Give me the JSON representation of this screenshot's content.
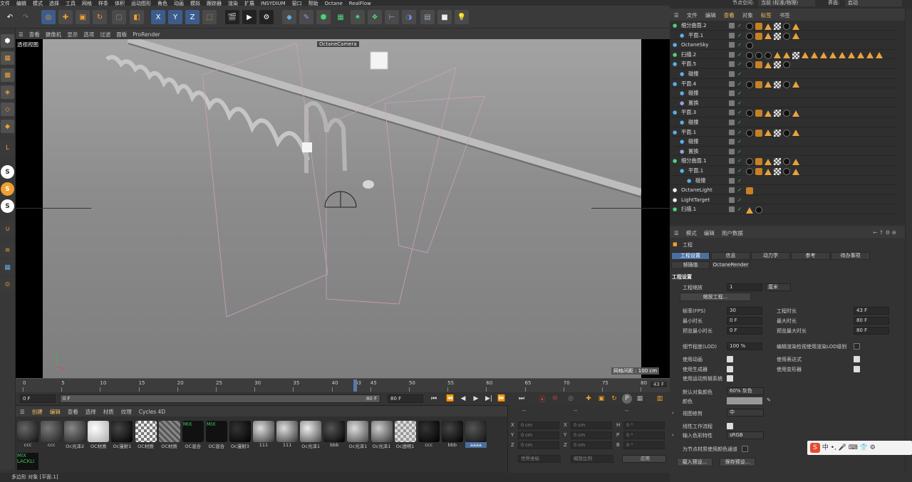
{
  "menubar": [
    "文件",
    "编辑",
    "模式",
    "选择",
    "工具",
    "网格",
    "样条",
    "体积",
    "运动图形",
    "角色",
    "动画",
    "模拟",
    "跟踪器",
    "渲染",
    "扩展",
    "INSYDIUM",
    "窗口",
    "帮助",
    "Octane",
    "RealFlow"
  ],
  "top_right": {
    "node_space_label": "节点空间:",
    "node_space_value": "当前 (标准/物理)",
    "interface_label": "界面:",
    "interface_value": "启动"
  },
  "viewport": {
    "menu": [
      "查看",
      "摄像机",
      "显示",
      "选项",
      "过滤",
      "面板",
      "ProRender"
    ],
    "label": "透视视图",
    "camera_label": "OctaneCamera",
    "grid_info": "网格间距 : 100 cm"
  },
  "timeline": {
    "ticks": [
      "0",
      "5",
      "10",
      "15",
      "20",
      "25",
      "30",
      "35",
      "40",
      "43",
      "45",
      "50",
      "55",
      "60",
      "65",
      "70",
      "75",
      "80"
    ],
    "current_frame": "43 F",
    "start_field": "0 F",
    "range_start": "0 F",
    "range_end": "80 F",
    "end_field": "80 F"
  },
  "materials": {
    "tabs": [
      "创建",
      "编辑",
      "查看",
      "选择",
      "材质",
      "纹理",
      "Cycles 4D"
    ],
    "items": [
      "ccc",
      "ccc",
      "Oc光泽2",
      "OC材质",
      "Oc漫射1",
      "OC材质",
      "OC材质",
      "OC混合",
      "OC混合",
      "Oc漫射3",
      "111",
      "111",
      "Oc光泽1",
      "bbb",
      "Oc光泽1",
      "Oc光泽1",
      "Oc透明1",
      "ccc",
      "bbb",
      "aaaa"
    ],
    "extra_label": "MIX\nLACKLI"
  },
  "coords": {
    "header": [
      "--",
      "--",
      "--"
    ],
    "rows": [
      {
        "a": "X",
        "v1": "0 cm",
        "b": "X",
        "v2": "0 cm",
        "c": "H",
        "v3": "0 °"
      },
      {
        "a": "Y",
        "v1": "0 cm",
        "b": "Y",
        "v2": "0 cm",
        "c": "P",
        "v3": "0 °"
      },
      {
        "a": "Z",
        "v1": "0 cm",
        "b": "Z",
        "v2": "0 cm",
        "c": "B",
        "v3": "0 °"
      }
    ],
    "mode": "世界坐标",
    "scale": "缩放比例",
    "apply": "应用"
  },
  "status": "多边形 对象 [平面.1]",
  "object_manager": {
    "menu": [
      "文件",
      "编辑",
      "查看",
      "对象",
      "标签",
      "书签"
    ],
    "rows": [
      {
        "name": "细分曲面.2",
        "indent": 0,
        "tags": "sotcst"
      },
      {
        "name": "平面.1",
        "indent": 1,
        "tags": "sotcst"
      },
      {
        "name": "OctaneSky",
        "indent": 0,
        "tags": "b"
      },
      {
        "name": "扫描.2",
        "indent": 0,
        "tags": "sssttcttttttttt"
      },
      {
        "name": "平面.5",
        "indent": 0,
        "tags": "sotcs"
      },
      {
        "name": "碰撞",
        "indent": 1,
        "tags": ""
      },
      {
        "name": "平面.4",
        "indent": 0,
        "tags": "sotcst"
      },
      {
        "name": "碰撞",
        "indent": 1,
        "tags": ""
      },
      {
        "name": "置换",
        "indent": 1,
        "tags": ""
      },
      {
        "name": "平面.3",
        "indent": 0,
        "tags": "sotcst"
      },
      {
        "name": "碰撞",
        "indent": 1,
        "tags": ""
      },
      {
        "name": "平面.1",
        "indent": 0,
        "tags": "sotcst"
      },
      {
        "name": "碰撞",
        "indent": 1,
        "tags": ""
      },
      {
        "name": "置换",
        "indent": 1,
        "tags": ""
      },
      {
        "name": "细分曲面.1",
        "indent": 0,
        "tags": "sotcst"
      },
      {
        "name": "平面.1",
        "indent": 1,
        "tags": "sotcst"
      },
      {
        "name": "碰撞",
        "indent": 2,
        "tags": ""
      },
      {
        "name": "OctaneLight",
        "indent": 0,
        "tags": "o"
      },
      {
        "name": "LightTarget",
        "indent": 0,
        "tags": ""
      },
      {
        "name": "扫描.1",
        "indent": 0,
        "tags": "ts"
      }
    ]
  },
  "attributes": {
    "menu": [
      "模式",
      "编辑",
      "用户数据"
    ],
    "title": "工程",
    "tabs": [
      "工程设置",
      "信息",
      "动力学",
      "参考",
      "待办事项",
      "帧插值",
      "OctaneRender"
    ],
    "section": "工程设置",
    "project_scale_label": "工程缩放",
    "project_scale_value": "1",
    "project_scale_unit": "厘米",
    "scale_project_btn": "缩放工程...",
    "fps_label": "帧率(FPS)",
    "fps_value": "30",
    "proj_len_label": "工程时长",
    "proj_len_value": "43 F",
    "min_len_label": "最小时长",
    "min_len_value": "0 F",
    "max_len_label": "最大时长",
    "max_len_value": "80 F",
    "prev_min_label": "预览最小时长",
    "prev_min_value": "0 F",
    "prev_max_label": "预览最大时长",
    "prev_max_value": "80 F",
    "lod_label": "细节程度(LOD)",
    "lod_value": "100 %",
    "lod_render_label": "编辑渲染检视使用渲染LOD级别",
    "use_anim": "使用动画",
    "use_expr": "使用表达式",
    "use_gen": "使用生成器",
    "use_deform": "使用变形器",
    "use_motion": "使用运动剪辑系统",
    "default_color_label": "默认对象颜色",
    "default_color_value": "60% 灰色",
    "color_label": "颜色",
    "view_clip_label": "视图修剪",
    "view_clip_value": "中",
    "linear_label": "线性工作流程",
    "input_color_label": "输入色彩特性",
    "input_color_value": "sRGB",
    "node_color_label": "为节点材质使用颜色通道",
    "load_preset": "载入预设...",
    "save_preset": "保存预设..."
  },
  "ime": "中 •, 🎤 ⌨ 👕 ⚙"
}
